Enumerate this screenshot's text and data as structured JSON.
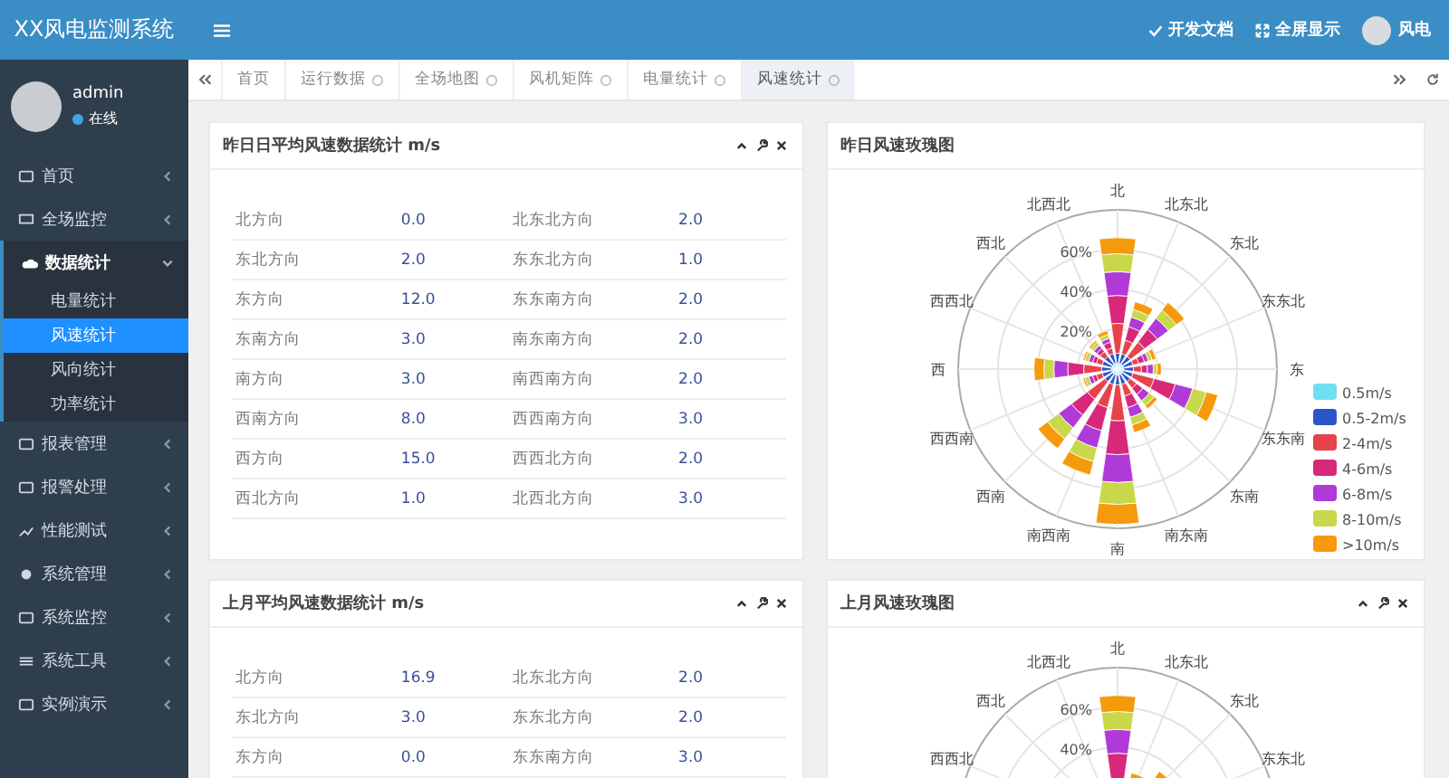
{
  "app": {
    "title": "XX风电监测系统",
    "user": {
      "name": "admin",
      "status": "在线"
    },
    "header_links": [
      "开发文档",
      "全屏显示"
    ],
    "header_user": "风电"
  },
  "sidebar": {
    "items": [
      {
        "label": "首页",
        "expanded": false,
        "selected": false
      },
      {
        "label": "全场监控",
        "expanded": false,
        "selected": false
      },
      {
        "label": "数据统计",
        "expanded": true,
        "selected": false,
        "children": [
          {
            "label": "电量统计",
            "selected": false
          },
          {
            "label": "风速统计",
            "selected": true
          },
          {
            "label": "风向统计",
            "selected": false
          },
          {
            "label": "功率统计",
            "selected": false
          }
        ]
      },
      {
        "label": "报表管理",
        "expanded": false,
        "selected": false
      },
      {
        "label": "报警处理",
        "expanded": false,
        "selected": false
      },
      {
        "label": "性能测试",
        "expanded": false,
        "selected": false
      },
      {
        "label": "系统管理",
        "expanded": false,
        "selected": false
      },
      {
        "label": "系统监控",
        "expanded": false,
        "selected": false
      },
      {
        "label": "系统工具",
        "expanded": false,
        "selected": false
      },
      {
        "label": "实例演示",
        "expanded": false,
        "selected": false
      }
    ]
  },
  "tabs": [
    {
      "label": "首页",
      "selected": false,
      "closable": false
    },
    {
      "label": "运行数据",
      "selected": false,
      "closable": true
    },
    {
      "label": "全场地图",
      "selected": false,
      "closable": true
    },
    {
      "label": "风机矩阵",
      "selected": false,
      "closable": true
    },
    {
      "label": "电量统计",
      "selected": false,
      "closable": true
    },
    {
      "label": "风速统计",
      "selected": true,
      "closable": true
    }
  ],
  "panels": [
    {
      "kind": "table",
      "title": "昨日日平均风速数据统计 m/s",
      "tools": true,
      "rows": [
        {
          "dir1": "北方向",
          "val1": "0.0",
          "dir2": "北东北方向",
          "val2": "2.0"
        },
        {
          "dir1": "东北方向",
          "val1": "2.0",
          "dir2": "东东北方向",
          "val2": "1.0"
        },
        {
          "dir1": "东方向",
          "val1": "12.0",
          "dir2": "东东南方向",
          "val2": "2.0"
        },
        {
          "dir1": "东南方向",
          "val1": "3.0",
          "dir2": "南东南方向",
          "val2": "2.0"
        },
        {
          "dir1": "南方向",
          "val1": "3.0",
          "dir2": "南西南方向",
          "val2": "2.0"
        },
        {
          "dir1": "西南方向",
          "val1": "8.0",
          "dir2": "西西南方向",
          "val2": "3.0"
        },
        {
          "dir1": "西方向",
          "val1": "15.0",
          "dir2": "西西北方向",
          "val2": "2.0"
        },
        {
          "dir1": "西北方向",
          "val1": "1.0",
          "dir2": "北西北方向",
          "val2": "3.0"
        }
      ]
    },
    {
      "kind": "rose",
      "title": "昨日风速玫瑰图",
      "tools": false,
      "direction_rows": [
        [
          "北"
        ],
        [
          "北西北",
          "北东北"
        ],
        [
          "西北",
          "东北"
        ],
        [
          "西西北",
          "东东北"
        ],
        [
          "西",
          "东"
        ],
        [
          "西西南",
          "东东南"
        ],
        [
          "西南",
          "东南"
        ],
        [
          "南西南",
          "南东南"
        ],
        [
          "南"
        ]
      ],
      "ring_labels": [
        "60%",
        "40%",
        "20%"
      ],
      "legend": [
        {
          "label": "0.5m/s",
          "color": "#6ee0f0"
        },
        {
          "label": "0.5-2m/s",
          "color": "#2c55c8"
        },
        {
          "label": "2-4m/s",
          "color": "#e8424a"
        },
        {
          "label": "4-6m/s",
          "color": "#d8287a"
        },
        {
          "label": "6-8m/s",
          "color": "#b03ad8"
        },
        {
          "label": "8-10m/s",
          "color": "#c8d84a"
        },
        {
          "label": ">10m/s",
          "color": "#f59a0a"
        }
      ]
    },
    {
      "kind": "table",
      "title": "上月平均风速数据统计 m/s",
      "tools": true,
      "rows": [
        {
          "dir1": "北方向",
          "val1": "16.9",
          "dir2": "北东北方向",
          "val2": "2.0"
        },
        {
          "dir1": "东北方向",
          "val1": "3.0",
          "dir2": "东东北方向",
          "val2": "2.0"
        },
        {
          "dir1": "东方向",
          "val1": "0.0",
          "dir2": "东东南方向",
          "val2": "3.0"
        }
      ]
    },
    {
      "kind": "rose",
      "title": "上月风速玫瑰图",
      "tools": true,
      "direction_rows": [
        [
          "北"
        ],
        [
          "北西北",
          "北东北"
        ],
        [
          "西北",
          "东北"
        ],
        [
          "西西北",
          "东东北"
        ]
      ],
      "ring_labels": [
        "60%",
        "40%"
      ]
    }
  ]
}
